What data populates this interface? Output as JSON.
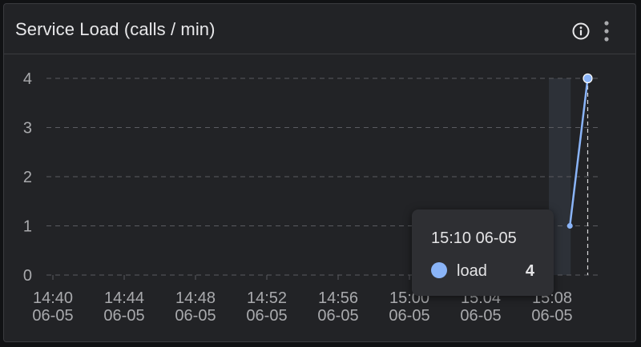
{
  "panel": {
    "title": "Service Load (calls / min)",
    "info_icon": "info-circle-icon",
    "menu_icon": "vertical-ellipsis-icon"
  },
  "colors": {
    "panel_bg": "#222326",
    "grid": "#5a5b60",
    "axis_text": "#a9aaad",
    "series": "#8ab4f8",
    "highlight_band": "#2d3138",
    "tooltip_bg": "#2e2f33"
  },
  "chart_data": {
    "type": "line",
    "x_tick_labels": [
      [
        "14:40",
        "06-05"
      ],
      [
        "14:44",
        "06-05"
      ],
      [
        "14:48",
        "06-05"
      ],
      [
        "14:52",
        "06-05"
      ],
      [
        "14:56",
        "06-05"
      ],
      [
        "15:00",
        "06-05"
      ],
      [
        "15:04",
        "06-05"
      ],
      [
        "15:08",
        "06-05"
      ]
    ],
    "x_range": [
      "14:40 06-05",
      "15:10 06-05"
    ],
    "y_ticks": [
      0,
      1,
      2,
      3,
      4
    ],
    "ylim": [
      0,
      4
    ],
    "grid": "horizontal dashed",
    "series": [
      {
        "name": "load",
        "points": [
          {
            "x": "15:09 06-05",
            "y": 1
          },
          {
            "x": "15:10 06-05",
            "y": 4
          }
        ]
      }
    ],
    "highlight": {
      "x_from": "15:08 06-05",
      "x_to": "15:09 06-05"
    },
    "crosshair_x": "15:10 06-05"
  },
  "tooltip": {
    "time": "15:10 06-05",
    "series_name": "load",
    "value": "4"
  }
}
